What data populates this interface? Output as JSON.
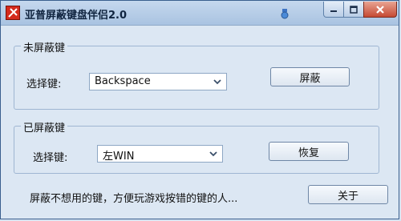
{
  "window": {
    "title": "亚普屏蔽键盘伴侣2.0"
  },
  "unblocked_group": {
    "legend": "未屏蔽键",
    "select_label": "选择键:",
    "selected_key": "Backspace",
    "action_label": "屏蔽"
  },
  "blocked_group": {
    "legend": "已屏蔽键",
    "select_label": "选择键:",
    "selected_key": "左WIN",
    "action_label": "恢复"
  },
  "footer": {
    "description": "屏蔽不想用的键，方便玩游戏按错的键的人...",
    "about_label": "关于"
  },
  "colors": {
    "background": "#dce7f3",
    "titlebar": "#b6cde8",
    "close_button": "#c54a33",
    "app_icon": "#d42a1c"
  }
}
